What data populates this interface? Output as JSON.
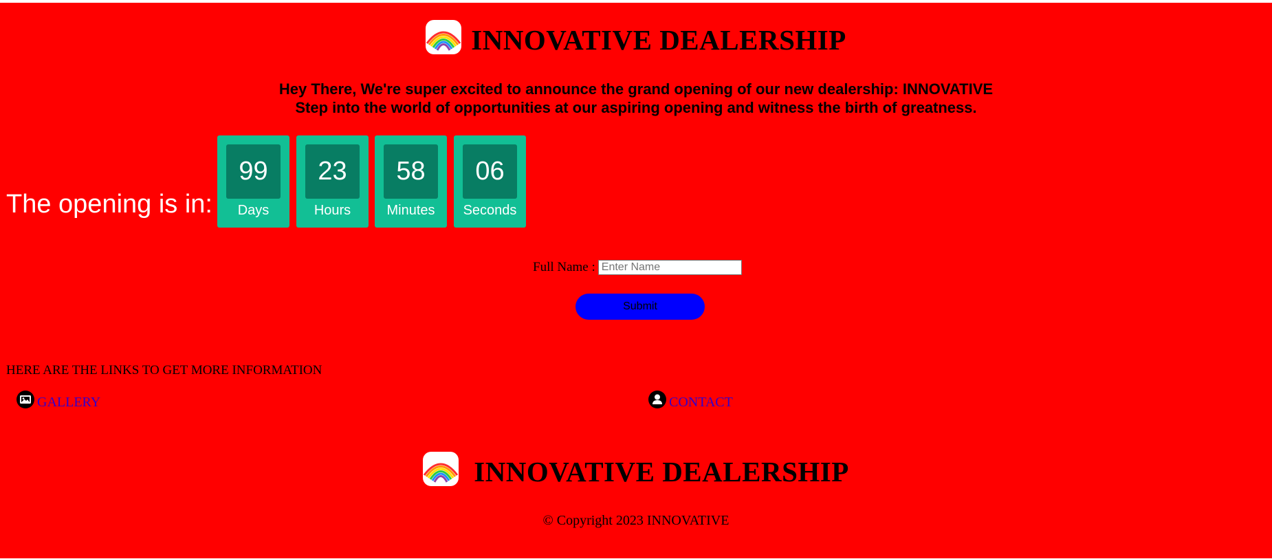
{
  "brand": {
    "title": "INNOVATIVE DEALERSHIP",
    "logo_icon": "rainbow-logo-icon"
  },
  "intro": {
    "line1": "Hey There, We're super excited to announce the grand opening of our new dealership: INNOVATIVE",
    "line2": "Step into the world of opportunities at our aspiring opening and witness the birth of greatness."
  },
  "countdown": {
    "label": "The opening is in:",
    "units": [
      {
        "value": "99",
        "unit": "Days"
      },
      {
        "value": "23",
        "unit": "Hours"
      },
      {
        "value": "58",
        "unit": "Minutes"
      },
      {
        "value": "06",
        "unit": "Seconds"
      }
    ]
  },
  "form": {
    "label": "Full Name :",
    "placeholder": "Enter Name",
    "value": "",
    "submit_label": "Submit"
  },
  "links": {
    "heading": "HERE ARE THE LINKS TO GET MORE INFORMATION",
    "gallery": {
      "label": "GALLERY",
      "icon": "image-icon"
    },
    "contact": {
      "label": "CONTACT",
      "icon": "user-icon"
    }
  },
  "footer": {
    "title": "INNOVATIVE DEALERSHIP",
    "copyright": "© Copyright 2023 INNOVATIVE"
  },
  "colors": {
    "page_background": "#ff0000",
    "countdown_box": "#12bf95",
    "countdown_number_box": "#087d63",
    "submit_button": "#0000ff",
    "link_text": "#3300cc"
  }
}
